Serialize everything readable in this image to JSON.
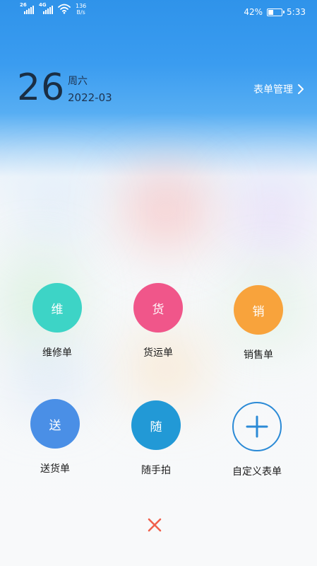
{
  "status_bar": {
    "sim1_label": "26",
    "sim2_label": "4G",
    "net_speed_value": "136",
    "net_speed_unit": "B/s",
    "battery_percent": "42%",
    "battery_level": 0.42,
    "time": "5:33"
  },
  "header": {
    "day": "26",
    "weekday": "周六",
    "year_month": "2022-03",
    "manage_label": "表单管理"
  },
  "tiles": [
    {
      "glyph": "维",
      "label": "维修单",
      "color": "#3dd4c6"
    },
    {
      "glyph": "货",
      "label": "货运单",
      "color": "#f0568a"
    },
    {
      "glyph": "销",
      "label": "销售单",
      "color": "#f8a33c"
    },
    {
      "glyph": "送",
      "label": "送货单",
      "color": "#4a8fe6"
    },
    {
      "glyph": "随",
      "label": "随手拍",
      "color": "#2299d6"
    },
    {
      "glyph": "+",
      "label": "自定义表单",
      "color": "#2b8ad6"
    }
  ],
  "colors": {
    "accent_blue": "#2f93ea",
    "close_icon": "#f0604c"
  }
}
